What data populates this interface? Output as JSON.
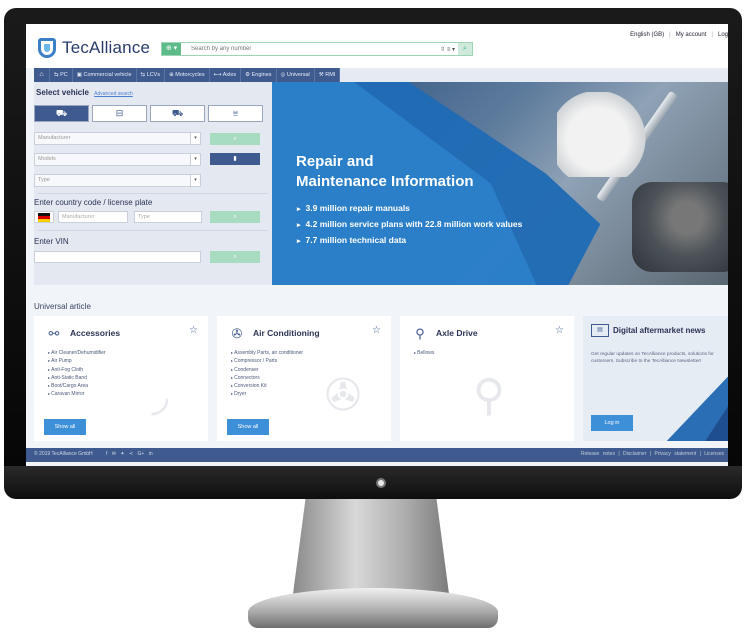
{
  "header": {
    "logo_text": "TecAlliance",
    "search_type": "⊕ ▾",
    "search_placeholder": "Search by any number",
    "search_opts": "⇳ ≡ ▾",
    "search_btn": "⌕",
    "language": "English (GB)",
    "my_account": "My account",
    "logout": "Log"
  },
  "nav": [
    "PC",
    "Commercial vehicle",
    "LCVs",
    "Motorcycles",
    "Axles",
    "Engines",
    "Universal",
    "RMI"
  ],
  "left": {
    "select_vehicle": "Select vehicle",
    "advanced_search": "Advanced search",
    "manufacturer_ph": "Manufacturer",
    "models_ph": "Models",
    "type_ph": "Type",
    "country_title": "Enter country code / license plate",
    "plate_manufacturer_ph": "Manufacturer",
    "plate_type_ph": "Type",
    "vin_title": "Enter VIN"
  },
  "hero": {
    "title_line1": "Repair and",
    "title_line2": "Maintenance Information",
    "bullets": [
      "3.9 million repair manuals",
      "4.2 million service plans with 22.8 million work values",
      "7.7 million technical data"
    ]
  },
  "universal": {
    "title": "Universal article",
    "cards": [
      {
        "title": "Accessories",
        "items": [
          "Air Cleaner/Dehumidifier",
          "Air Pump",
          "Anti-Fog Cloth",
          "Anti-Static Band",
          "Boot/Cargo Area",
          "Caravan Mirror"
        ],
        "button": "Show all"
      },
      {
        "title": "Air Conditioning",
        "items": [
          "Assembly Parts, air conditioner",
          "Compressor / Parts",
          "Condenser",
          "Connectors",
          "Conversion Kit",
          "Dryer"
        ],
        "button": "Show all"
      },
      {
        "title": "Axle Drive",
        "items": [
          "Bellows"
        ],
        "button": ""
      }
    ],
    "news": {
      "title": "Digital aftermarket news",
      "text": "Get regular updates on TecAlliance products, solutions for customers. Subscribe to the TecAlliance Newsletter!",
      "button": "Log in"
    }
  },
  "footer": {
    "copyright": "© 2019 TecAlliance GmbH",
    "social": "f  ✉  ✦  ≺  G+  in",
    "links": "Release notes  |  Disclaimer  |  Privacy statement  |  Licenses"
  }
}
